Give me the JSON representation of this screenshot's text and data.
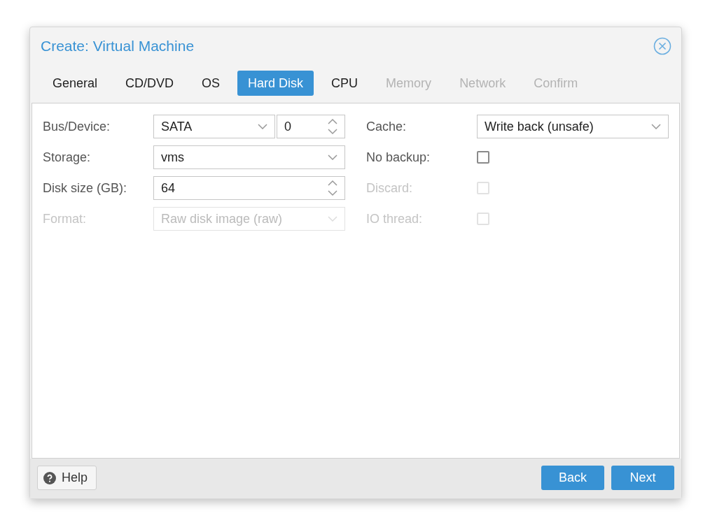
{
  "window": {
    "title": "Create: Virtual Machine"
  },
  "tabs": [
    {
      "label": "General",
      "selected": false,
      "disabled": false
    },
    {
      "label": "CD/DVD",
      "selected": false,
      "disabled": false
    },
    {
      "label": "OS",
      "selected": false,
      "disabled": false
    },
    {
      "label": "Hard Disk",
      "selected": true,
      "disabled": false
    },
    {
      "label": "CPU",
      "selected": false,
      "disabled": false
    },
    {
      "label": "Memory",
      "selected": false,
      "disabled": true
    },
    {
      "label": "Network",
      "selected": false,
      "disabled": true
    },
    {
      "label": "Confirm",
      "selected": false,
      "disabled": true
    }
  ],
  "left_fields": [
    {
      "label": "Bus/Device:",
      "disabled": false,
      "controls": [
        {
          "kind": "select",
          "value": "SATA"
        },
        {
          "kind": "spinner",
          "value": "0"
        }
      ]
    },
    {
      "label": "Storage:",
      "disabled": false,
      "controls": [
        {
          "kind": "select",
          "value": "vms"
        }
      ]
    },
    {
      "label": "Disk size (GB):",
      "disabled": false,
      "controls": [
        {
          "kind": "spinner",
          "value": "64"
        }
      ]
    },
    {
      "label": "Format:",
      "disabled": true,
      "controls": [
        {
          "kind": "select",
          "value": "Raw disk image (raw)"
        }
      ]
    }
  ],
  "right_fields": [
    {
      "label": "Cache:",
      "disabled": false,
      "kind": "select",
      "value": "Write back (unsafe)"
    },
    {
      "label": "No backup:",
      "disabled": false,
      "kind": "checkbox",
      "checked": false
    },
    {
      "label": "Discard:",
      "disabled": true,
      "kind": "checkbox",
      "checked": false
    },
    {
      "label": "IO thread:",
      "disabled": true,
      "kind": "checkbox",
      "checked": false
    }
  ],
  "footer": {
    "help": "Help",
    "buttons": [
      "Back",
      "Next"
    ]
  }
}
